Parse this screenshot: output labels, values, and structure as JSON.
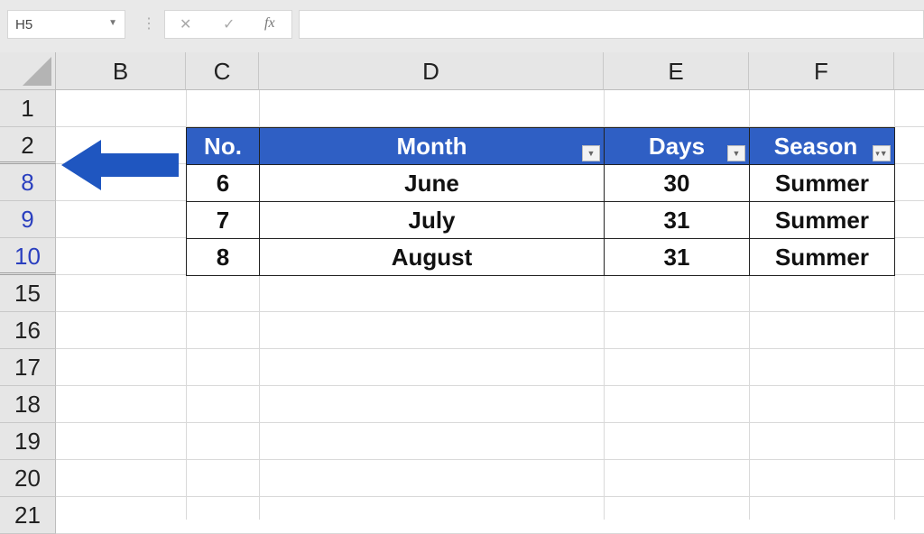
{
  "formula_bar": {
    "name_box": "H5",
    "cancel_icon": "✕",
    "enter_icon": "✓",
    "fx_icon": "fx",
    "formula_value": ""
  },
  "columns": [
    "B",
    "C",
    "D",
    "E",
    "F"
  ],
  "rows": [
    {
      "label": "1",
      "filtered": false
    },
    {
      "label": "2",
      "filtered": false
    },
    {
      "label": "8",
      "filtered": true
    },
    {
      "label": "9",
      "filtered": true
    },
    {
      "label": "10",
      "filtered": true
    },
    {
      "label": "15",
      "filtered": false
    },
    {
      "label": "16",
      "filtered": false
    },
    {
      "label": "17",
      "filtered": false
    },
    {
      "label": "18",
      "filtered": false
    },
    {
      "label": "19",
      "filtered": false
    },
    {
      "label": "20",
      "filtered": false
    },
    {
      "label": "21",
      "filtered": false
    }
  ],
  "table": {
    "headers": [
      "No.",
      "Month",
      "Days",
      "Season"
    ],
    "rows": [
      [
        "6",
        "June",
        "30",
        "Summer"
      ],
      [
        "7",
        "July",
        "31",
        "Summer"
      ],
      [
        "8",
        "August",
        "31",
        "Summer"
      ]
    ],
    "header_color": "#2f5fc4"
  },
  "annotation": {
    "arrow_color": "#1f56c0",
    "direction": "left"
  }
}
